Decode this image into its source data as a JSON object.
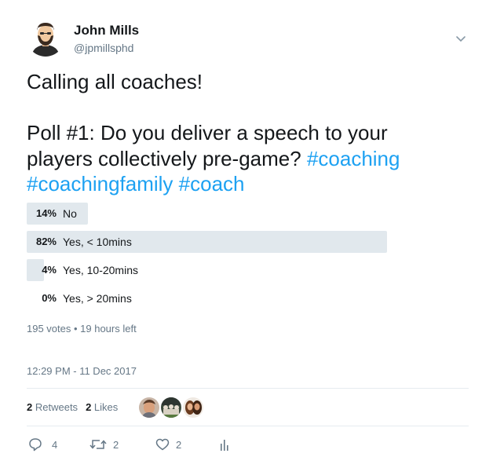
{
  "author": {
    "name": "John Mills",
    "handle": "@jpmillsphd"
  },
  "tweet": {
    "line1": "Calling all coaches!",
    "line2": "Poll #1: Do you deliver a speech to your",
    "line3_text": "players collectively pre-game? ",
    "line3_tag": "#coaching",
    "line4_tag1": "#coachingfamily",
    "line4_tag2": "#coach",
    "hashtag_color": "#1da1f2"
  },
  "poll": {
    "options": [
      {
        "pct": "14%",
        "label": "No",
        "fraction": 0.14
      },
      {
        "pct": "82%",
        "label": "Yes, < 10mins",
        "fraction": 0.82
      },
      {
        "pct": "4%",
        "label": "Yes, 10-20mins",
        "fraction": 0.04
      },
      {
        "pct": "0%",
        "label": "Yes, > 20mins",
        "fraction": 0.0
      }
    ],
    "meta": "195 votes • 19 hours left",
    "bar_color": "#e1e8ed"
  },
  "timestamp": "12:29 PM - 11 Dec 2017",
  "stats": {
    "retweets_count": "2",
    "retweets_label": "Retweets",
    "likes_count": "2",
    "likes_label": "Likes"
  },
  "actions": {
    "reply_count": "4",
    "retweet_count": "2",
    "like_count": "2"
  },
  "icons": [
    "chevron-down-icon",
    "reply-icon",
    "retweet-icon",
    "heart-icon",
    "analytics-icon"
  ]
}
